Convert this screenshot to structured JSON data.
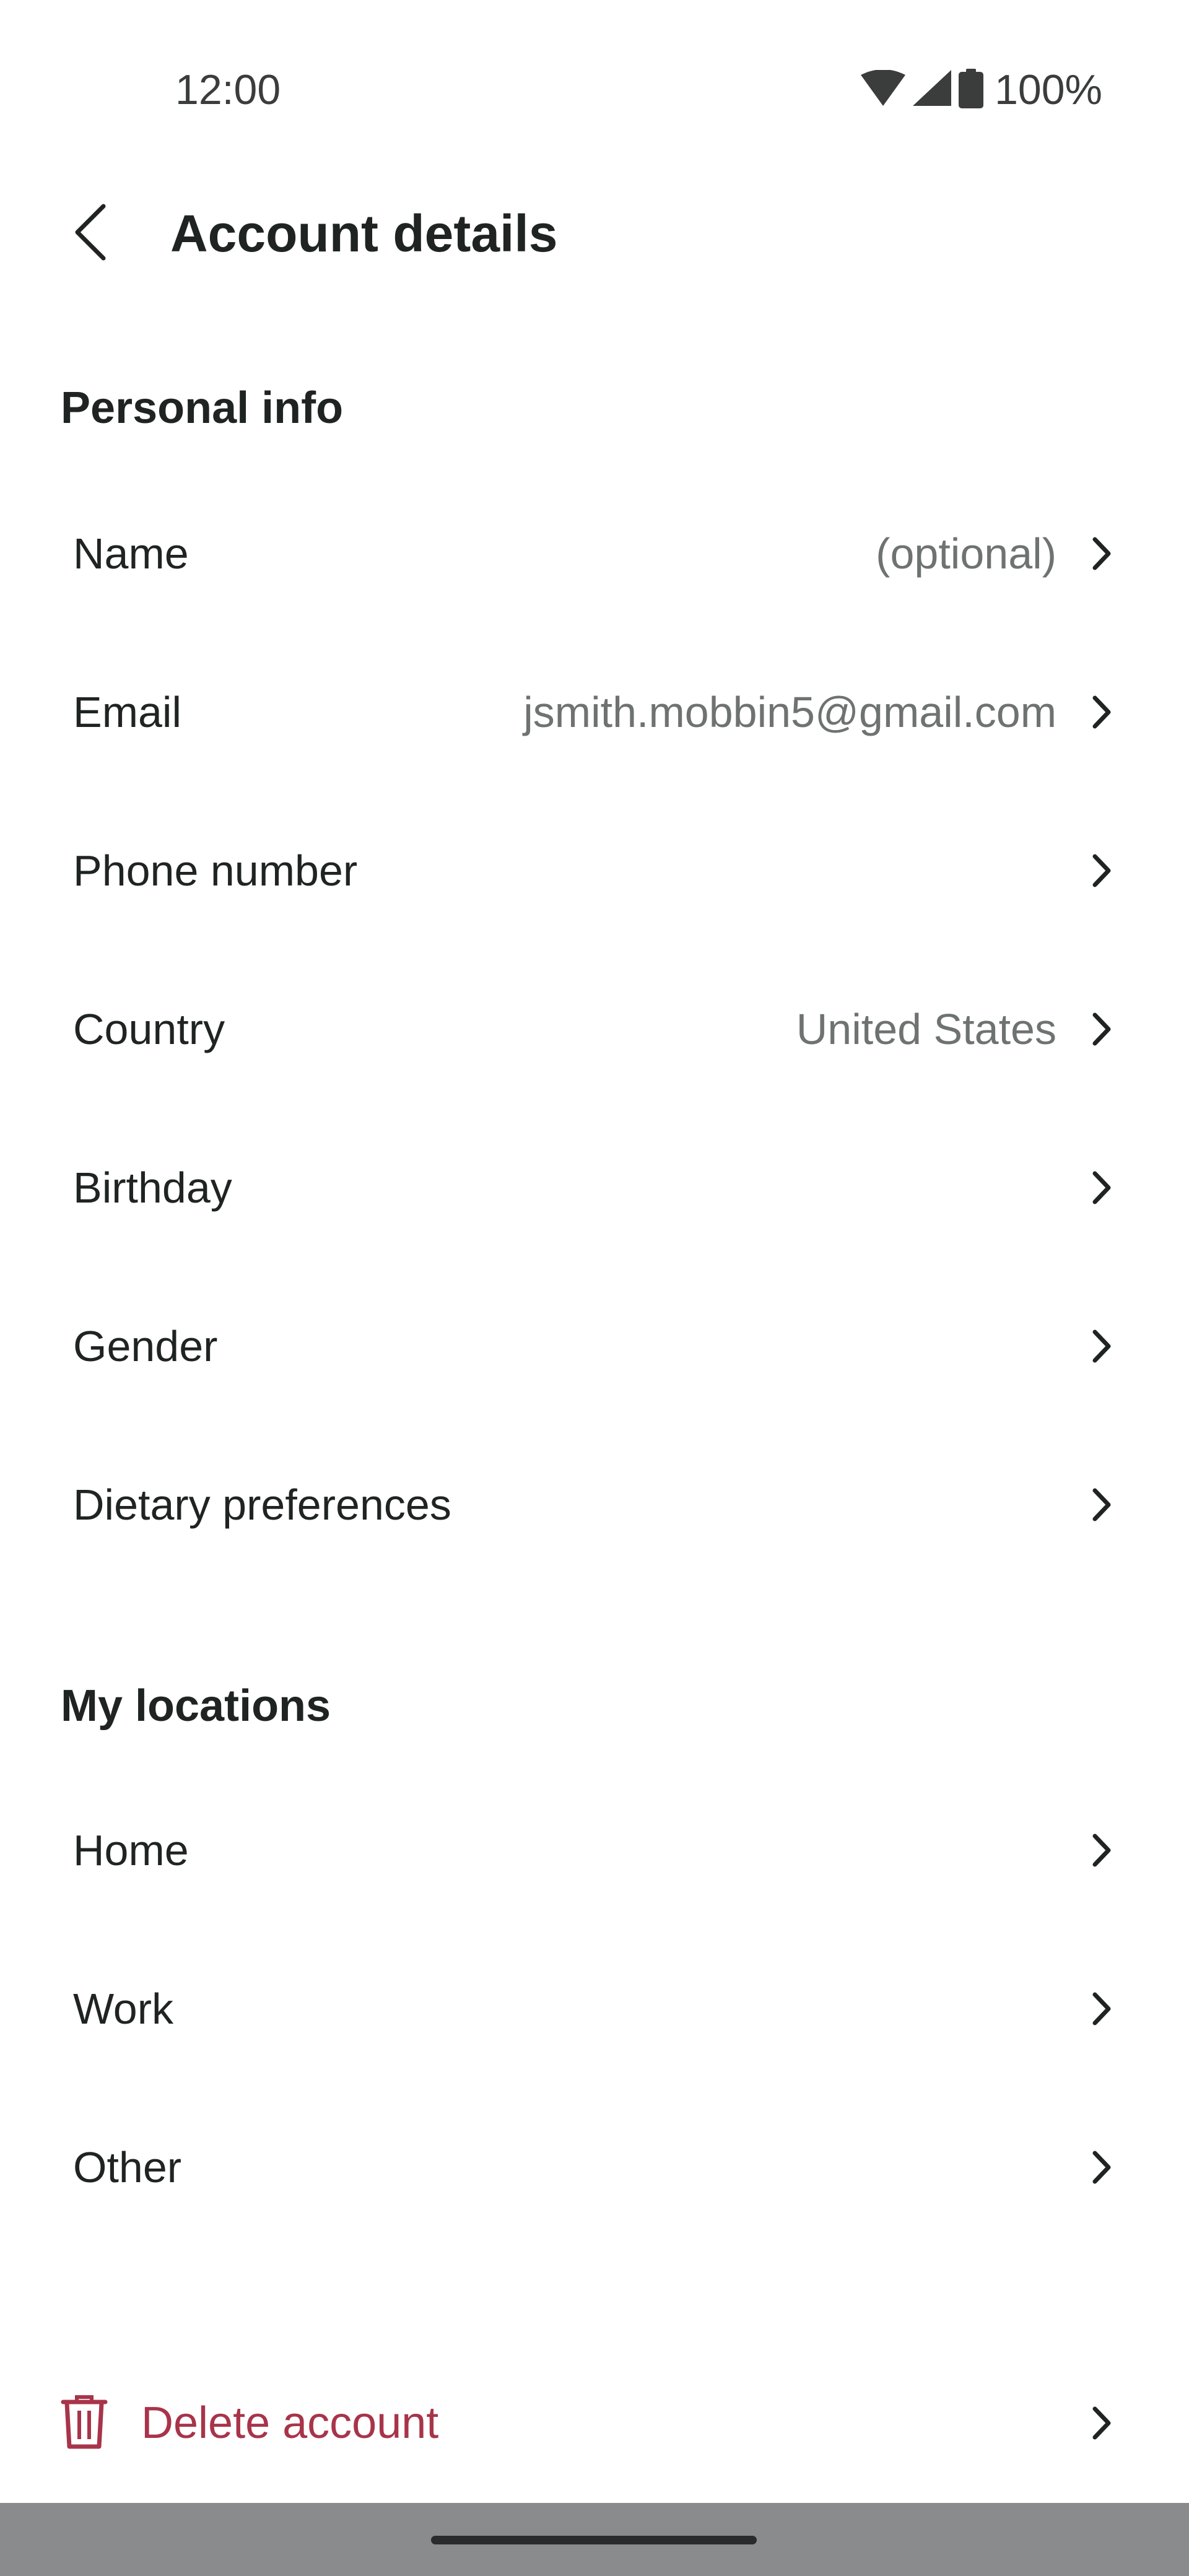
{
  "status_bar": {
    "time": "12:00",
    "battery": "100%"
  },
  "header": {
    "title": "Account details"
  },
  "personal_info": {
    "heading": "Personal info",
    "rows": [
      {
        "label": "Name",
        "value": "(optional)"
      },
      {
        "label": "Email",
        "value": "jsmith.mobbin5@gmail.com"
      },
      {
        "label": "Phone number",
        "value": ""
      },
      {
        "label": "Country",
        "value": "United States"
      },
      {
        "label": "Birthday",
        "value": ""
      },
      {
        "label": "Gender",
        "value": ""
      },
      {
        "label": "Dietary preferences",
        "value": ""
      }
    ]
  },
  "my_locations": {
    "heading": "My locations",
    "rows": [
      {
        "label": "Home"
      },
      {
        "label": "Work"
      },
      {
        "label": "Other"
      }
    ]
  },
  "delete_account": {
    "label": "Delete account"
  },
  "colors": {
    "text_primary": "#1f2423",
    "text_secondary": "#6e7271",
    "danger": "#a8344a",
    "nav_bar": "#8a8b8d"
  }
}
